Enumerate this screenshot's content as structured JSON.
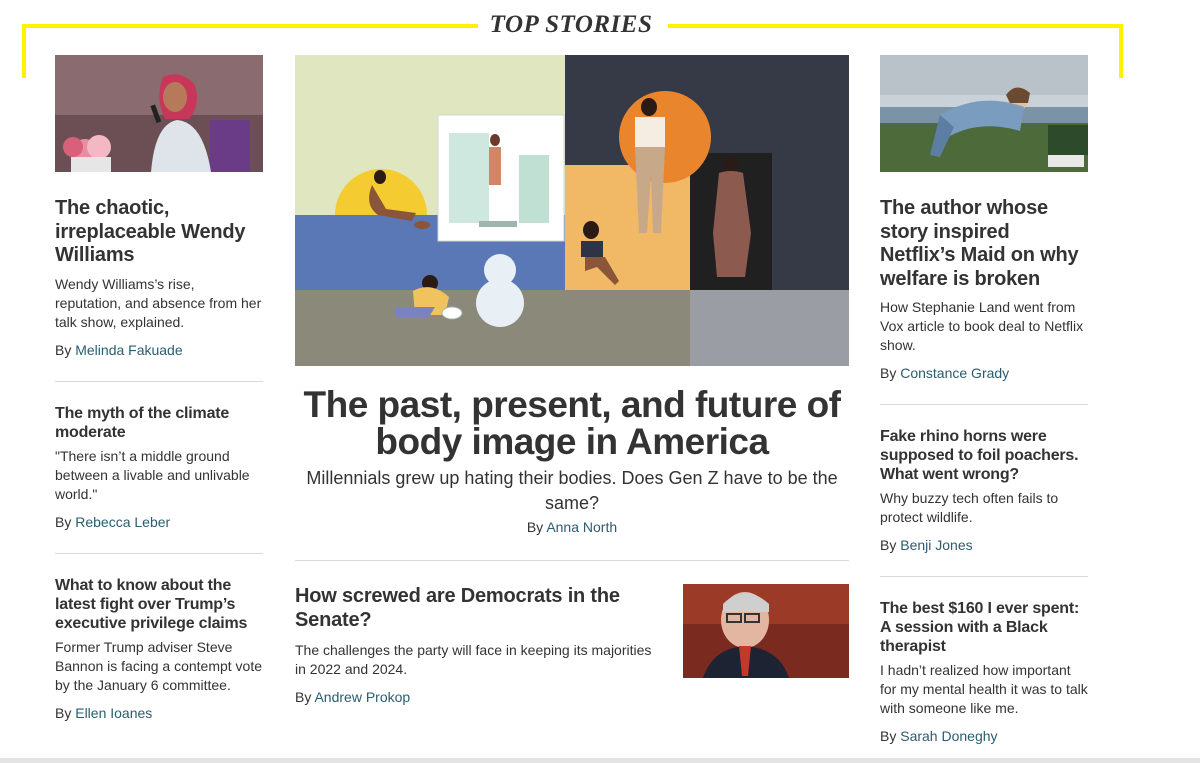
{
  "section": {
    "title": "TOP STORIES"
  },
  "colors": {
    "accent": "#fff200",
    "author_link": "#2a5d6e",
    "text": "#333333"
  },
  "byline_prefix": "By",
  "left": [
    {
      "title": "The chaotic, irreplaceable Wendy Williams",
      "dek": "Wendy Williams’s rise, reputation, and absence from her talk show, explained.",
      "author": "Melinda Fakuade"
    },
    {
      "title": "The myth of the climate moderate",
      "dek": "\"There isn’t a middle ground between a livable and unlivable world.\"",
      "author": "Rebecca Leber"
    },
    {
      "title": "What to know about the latest fight over Trump’s executive privilege claims",
      "dek": "Former Trump adviser Steve Bannon is facing a contempt vote by the January 6 committee.",
      "author": "Ellen Ioanes"
    }
  ],
  "center": {
    "hero": {
      "title": "The past, present, and future of body image in America",
      "dek": "Millennials grew up hating their bodies. Does Gen Z have to be the same?",
      "author": "Anna North"
    },
    "secondary": {
      "title": "How screwed are Democrats in the Senate?",
      "dek": "The challenges the party will face in keeping its majorities in 2022 and 2024.",
      "author": "Andrew Prokop"
    }
  },
  "right": [
    {
      "title": "The author whose story inspired Netflix’s Maid on why welfare is broken",
      "dek": "How Stephanie Land went from Vox article to book deal to Netflix show.",
      "author": "Constance Grady"
    },
    {
      "title": "Fake rhino horns were supposed to foil poachers. What went wrong?",
      "dek": "Why buzzy tech often fails to protect wildlife.",
      "author": "Benji Jones"
    },
    {
      "title": "The best $160 I ever spent: A session with a Black therapist",
      "dek": "I hadn’t realized how important for my mental health it was to talk with someone like me.",
      "author": "Sarah Doneghy"
    }
  ]
}
